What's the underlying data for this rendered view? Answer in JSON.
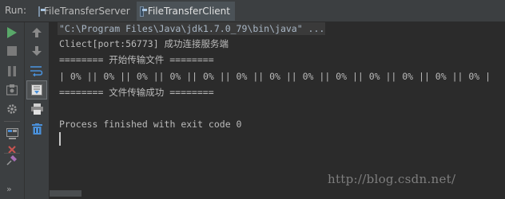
{
  "header": {
    "run_label": "Run:",
    "tabs": [
      {
        "label": "FileTransferServer",
        "active": false,
        "icon": "java-app-icon"
      },
      {
        "label": "FileTransferClient",
        "active": true,
        "icon": "java-app-icon"
      }
    ]
  },
  "toolbar": {
    "left_buttons": [
      "run-icon",
      "stop-icon",
      "pause-icon",
      "dump-threads-icon",
      "settings-icon",
      "layout-icon",
      "close-icon"
    ],
    "right_buttons": [
      "up-arrow-icon",
      "down-arrow-icon",
      "soft-wrap-icon",
      "scroll-to-end-icon",
      "print-icon",
      "trash-icon"
    ],
    "more_label": "»",
    "pin_icon": "pin-icon"
  },
  "console": {
    "command": "\"C:\\Program Files\\Java\\jdk1.7.0_79\\bin\\java\" ...",
    "line1": "Cliect[port:56773] 成功连接服务端",
    "line2": "======== 开始传输文件 ========",
    "line3": "| 0% || 0% || 0% || 0% || 0% || 0% || 0% || 0% || 0% || 0% || 0% || 0% || 0% |",
    "line4": "======== 文件传输成功 ========",
    "line5": "Process finished with exit code 0"
  },
  "watermark": "http://blog.csdn.net/",
  "colors": {
    "background": "#2b2b2b",
    "toolbar": "#3c3f41",
    "run_green": "#59a869",
    "text": "#bbbbbb",
    "accent_blue": "#4a90d9"
  }
}
